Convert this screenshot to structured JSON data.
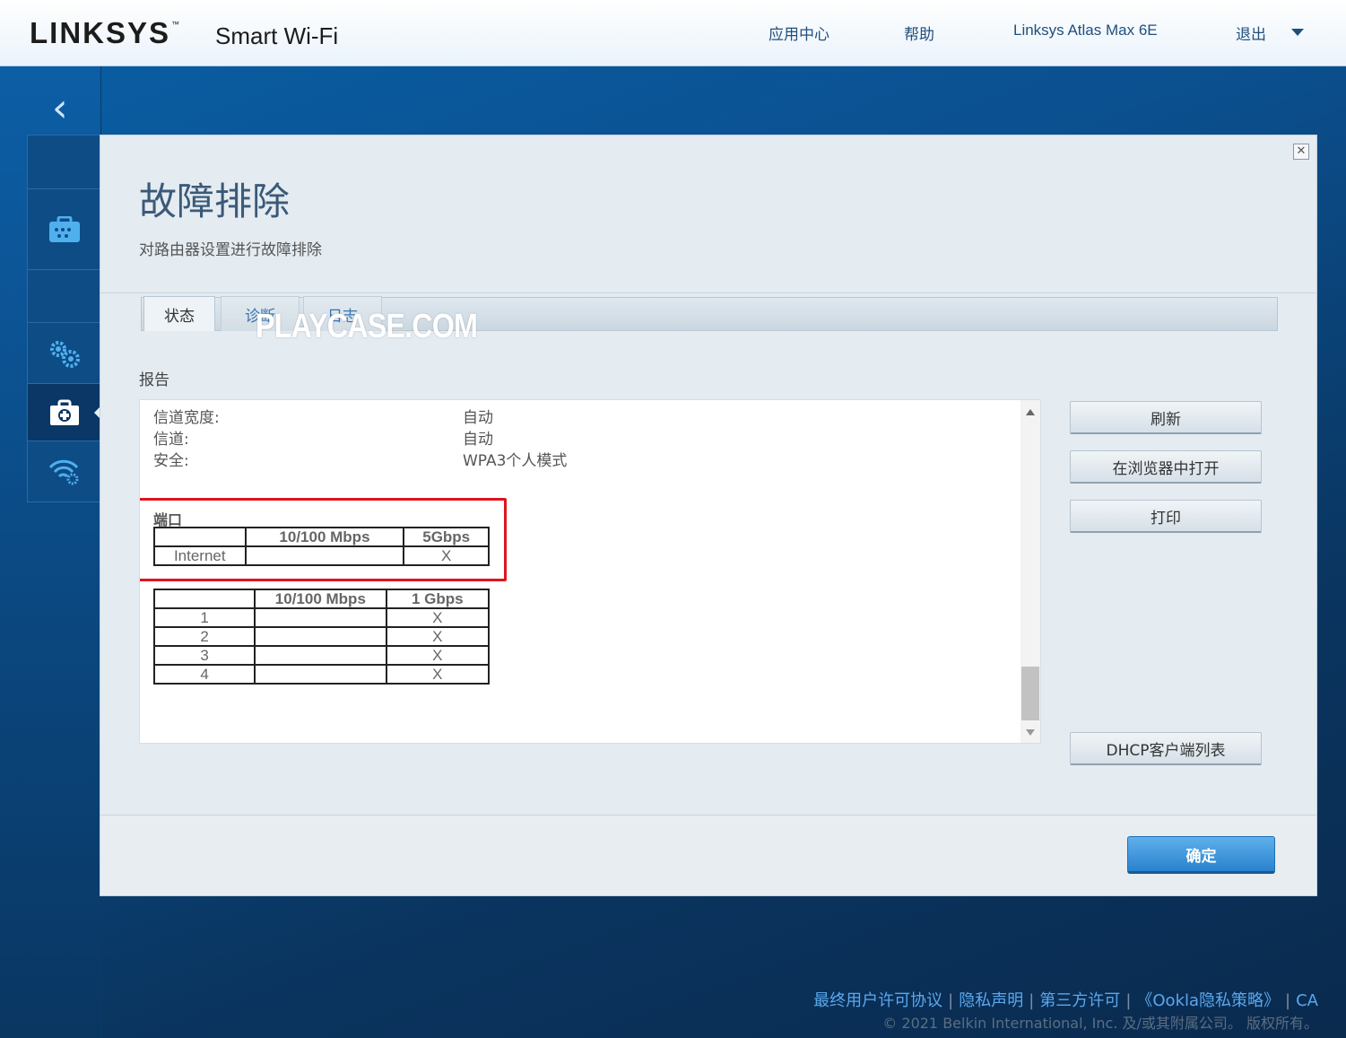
{
  "header": {
    "logo": "LINKSYS",
    "logo_tm": "™",
    "logo_sub": "Smart Wi-Fi",
    "nav": [
      "应用中心",
      "帮助",
      "Linksys Atlas Max 6E",
      "退出"
    ]
  },
  "modal": {
    "title": "故障排除",
    "subtitle": "对路由器设置进行故障排除",
    "tabs": [
      "状态",
      "诊断",
      "日志"
    ],
    "watermark": "PLAYCASE.COM",
    "report_label": "报告",
    "report": {
      "rows": [
        {
          "key": "信道宽度:",
          "value": "自动"
        },
        {
          "key": "信道:",
          "value": "自动"
        },
        {
          "key": "安全:",
          "value": "WPA3个人模式"
        }
      ],
      "port_title": "端口",
      "wan_table": {
        "headers": [
          "",
          "10/100 Mbps",
          "5Gbps"
        ],
        "rows": [
          [
            "Internet",
            "",
            "X"
          ]
        ]
      },
      "lan_table": {
        "headers": [
          "",
          "10/100 Mbps",
          "1 Gbps"
        ],
        "rows": [
          [
            "1",
            "",
            "X"
          ],
          [
            "2",
            "",
            "X"
          ],
          [
            "3",
            "",
            "X"
          ],
          [
            "4",
            "",
            "X"
          ]
        ]
      }
    },
    "buttons": {
      "refresh": "刷新",
      "open_browser": "在浏览器中打开",
      "print": "打印",
      "dhcp": "DHCP客户端列表"
    },
    "ok": "确定",
    "close_glyph": "✕"
  },
  "footer": {
    "links": [
      "最终用户许可协议",
      "隐私声明",
      "第三方许可",
      "《Ookla隐私策略》",
      "CA"
    ],
    "copyright": "© 2021 Belkin International, Inc. 及/或其附属公司。 版权所有。"
  },
  "colors": {
    "accent": "#2a82cd",
    "highlight": "#e0141e",
    "link": "#5aa8ee"
  }
}
